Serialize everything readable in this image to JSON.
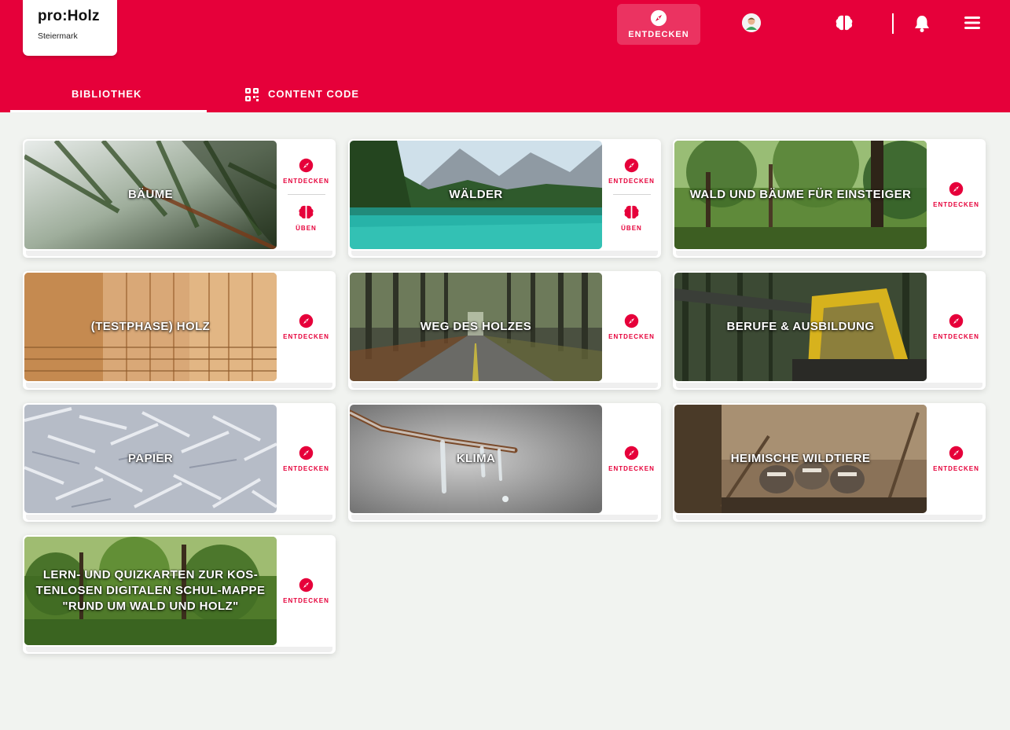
{
  "logo": {
    "title": "pro:Holz",
    "subtitle": "Steiermark"
  },
  "header": {
    "discover_label": "ENTDECKEN",
    "icons": [
      "compass-icon",
      "avatar",
      "brain-icon",
      "bell-icon",
      "menu-icon"
    ]
  },
  "tabs": [
    {
      "label": "BIBLIOTHEK",
      "active": true
    },
    {
      "label": "CONTENT CODE",
      "icon": "qr-code-icon"
    }
  ],
  "cards": [
    {
      "title": "BÄUME",
      "actions": [
        "ENTDECKEN",
        "ÜBEN"
      ]
    },
    {
      "title": "WÄLDER",
      "actions": [
        "ENTDECKEN",
        "ÜBEN"
      ]
    },
    {
      "title": "WALD UND BÄUME FÜR EINSTEIGER",
      "actions": [
        "ENTDECKEN"
      ]
    },
    {
      "title": "(TESTPHASE) HOLZ",
      "actions": [
        "ENTDECKEN"
      ]
    },
    {
      "title": "WEG DES HOLZES",
      "actions": [
        "ENTDECKEN"
      ]
    },
    {
      "title": "BERUFE & AUSBILDUNG",
      "actions": [
        "ENTDECKEN"
      ]
    },
    {
      "title": "PAPIER",
      "actions": [
        "ENTDECKEN"
      ]
    },
    {
      "title": "KLIMA",
      "actions": [
        "ENTDECKEN"
      ]
    },
    {
      "title": "HEIMISCHE WILDTIERE",
      "actions": [
        "ENTDECKEN"
      ]
    },
    {
      "title": "LERN- UND QUIZKARTEN ZUR KOS-TENLOSEN DIGITALEN SCHUL-MAPPE \"RUND UM WALD UND HOLZ\"",
      "actions": [
        "ENTDECKEN"
      ]
    }
  ],
  "colors": {
    "brand": "#e6003a",
    "background": "#f1f3f0"
  }
}
